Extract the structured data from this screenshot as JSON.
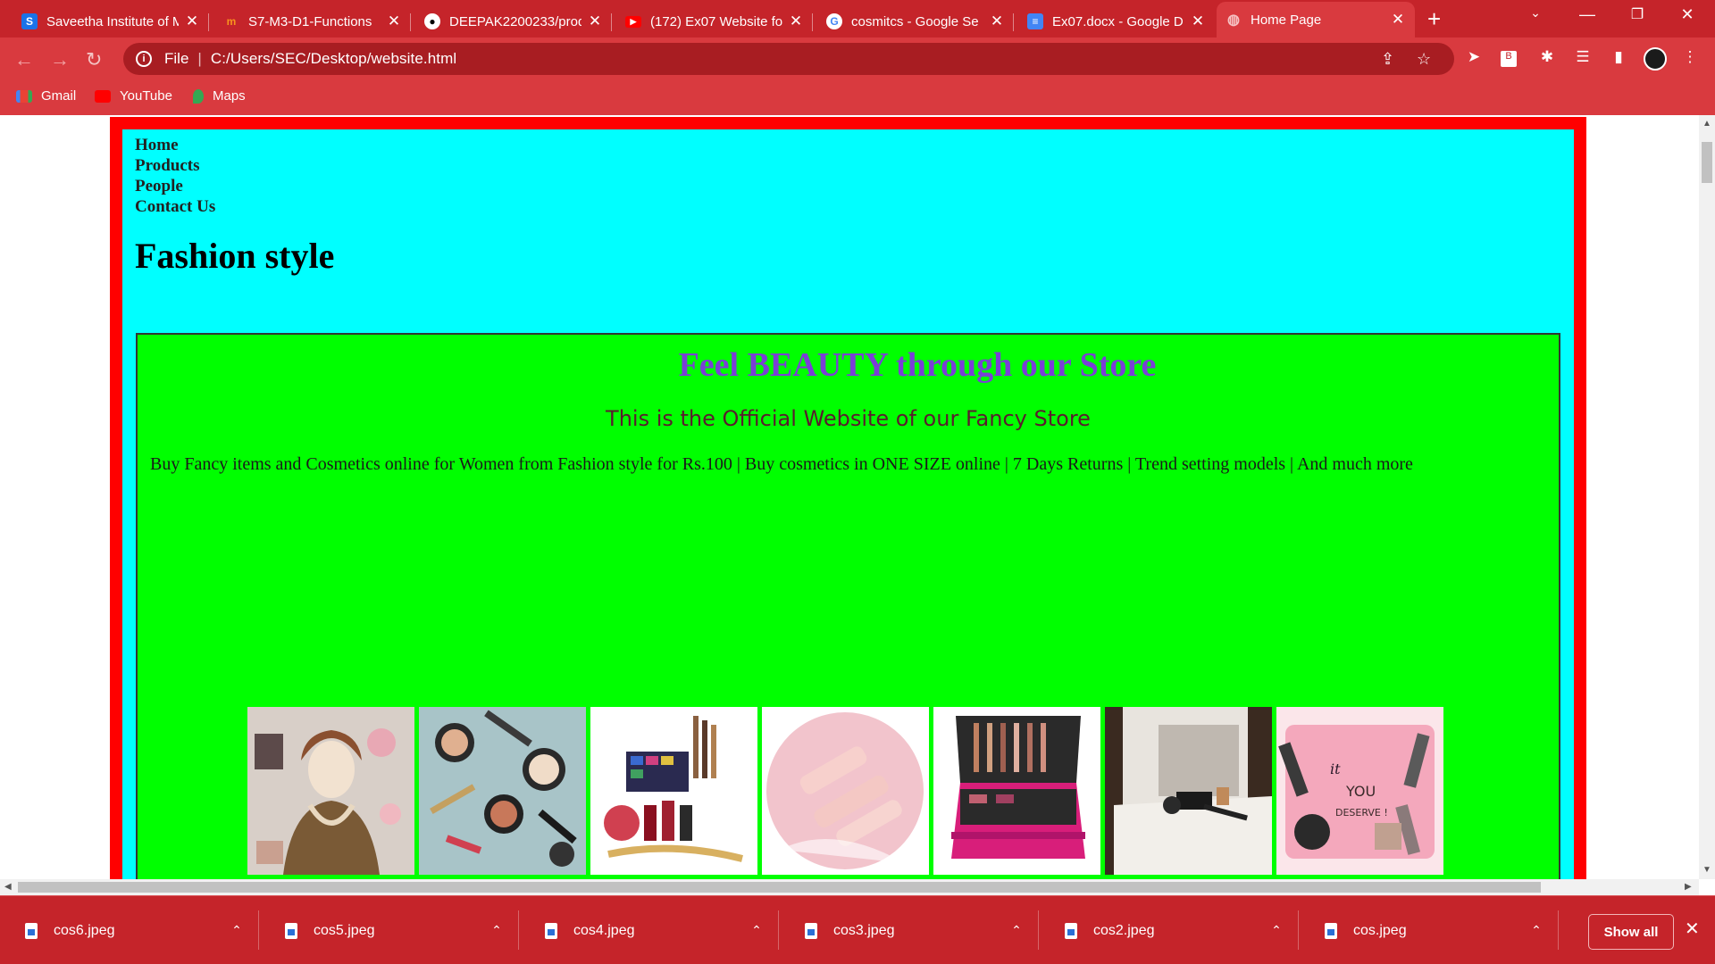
{
  "browser": {
    "tabs": [
      {
        "title": "Saveetha Institute of M",
        "icon": "s-icon",
        "icon_bg": "#1a73e8",
        "icon_letter": "S"
      },
      {
        "title": "S7-M3-D1-Functions",
        "icon": "moodle-icon",
        "icon_bg": "#f7931e",
        "icon_letter": "m"
      },
      {
        "title": "DEEPAK2200233/prod",
        "icon": "github-icon",
        "icon_bg": "#ffffff",
        "icon_letter": "●"
      },
      {
        "title": "(172) Ex07 Website fo",
        "icon": "youtube-icon",
        "icon_bg": "#ff0000",
        "icon_letter": "▶"
      },
      {
        "title": "cosmitcs - Google Se",
        "icon": "google-icon",
        "icon_bg": "#ffffff",
        "icon_letter": "G"
      },
      {
        "title": "Ex07.docx - Google D",
        "icon": "docs-icon",
        "icon_bg": "#4285f4",
        "icon_letter": "≡"
      },
      {
        "title": "Home Page",
        "icon": "globe-icon",
        "icon_bg": "#d93a3f",
        "icon_letter": "◍"
      }
    ],
    "address": {
      "scheme_label": "File",
      "url": "C:/Users/SEC/Desktop/website.html"
    },
    "bookmarks": [
      {
        "label": "Gmail",
        "icon": "gmail-icon",
        "color": "#ea4335"
      },
      {
        "label": "YouTube",
        "icon": "youtube-icon",
        "color": "#ff0000"
      },
      {
        "label": "Maps",
        "icon": "maps-icon",
        "color": "#34a853"
      }
    ]
  },
  "page": {
    "nav": [
      "Home",
      "Products",
      "People",
      "Contact Us"
    ],
    "site_title": "Fashion style",
    "hero_heading": "Feel BEAUTY through our Store",
    "hero_subheading": "This is the Official Website of our Fancy Store",
    "hero_description": "Buy Fancy items and Cosmetics online for Women from Fashion style for Rs.100 | Buy cosmetics in ONE SIZE online | 7 Days Returns | Trend setting models | And much more",
    "colors": {
      "frame": "#ff0000",
      "header_bg": "#00ffff",
      "content_bg": "#00ff00",
      "heading": "#7a3fd6",
      "chrome": "#c5242a"
    }
  },
  "downloads": {
    "items": [
      "cos6.jpeg",
      "cos5.jpeg",
      "cos4.jpeg",
      "cos3.jpeg",
      "cos2.jpeg",
      "cos.jpeg"
    ],
    "show_all_label": "Show all"
  }
}
